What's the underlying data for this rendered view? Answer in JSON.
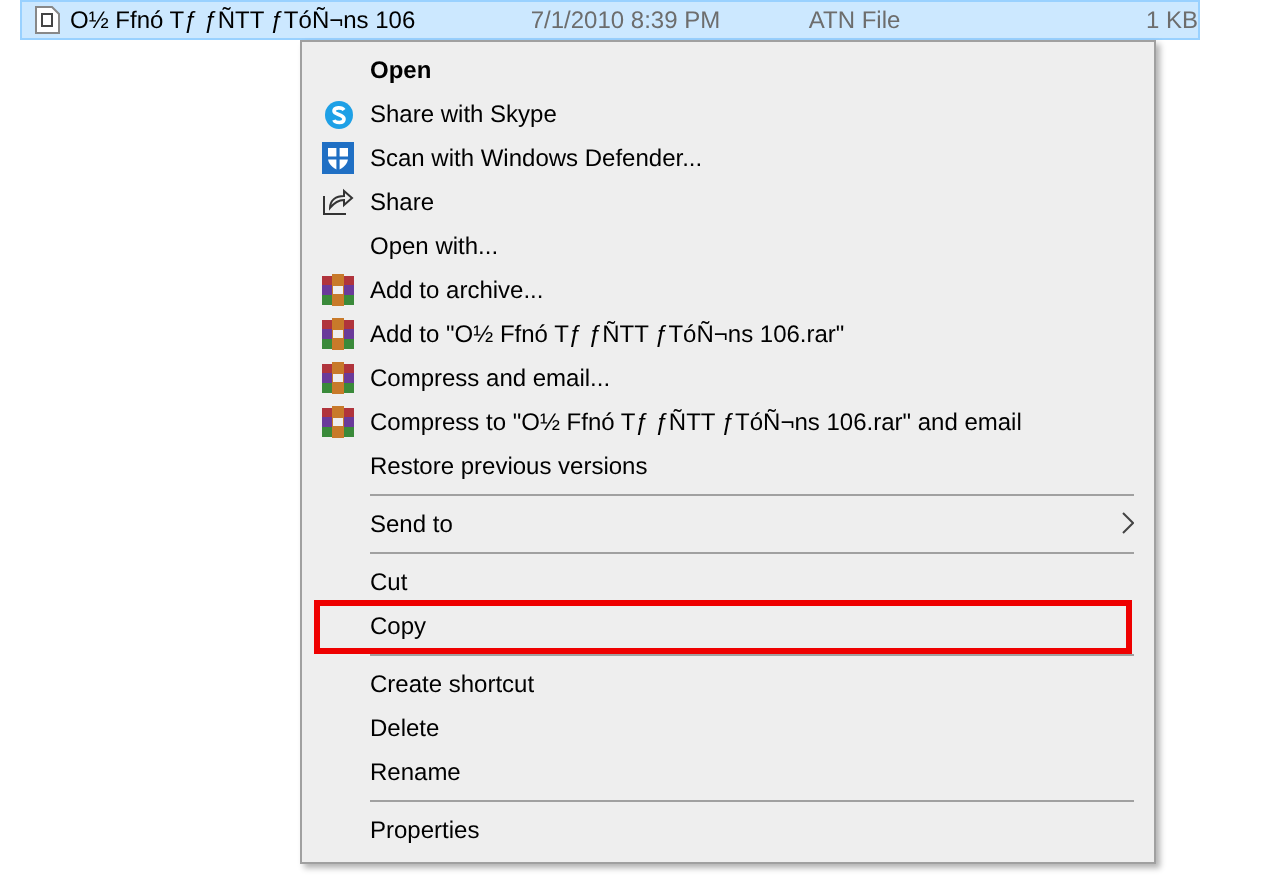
{
  "file_row": {
    "name": "O½ Ffnó Tƒ ƒÑTT ƒTóÑ¬ns 106",
    "date": "7/1/2010 8:39 PM",
    "type": "ATN File",
    "size": "1 KB",
    "selected": true
  },
  "context_menu": {
    "items": [
      {
        "kind": "plain",
        "label": "Open",
        "default": true,
        "submenu": false,
        "highlighted": false
      },
      {
        "kind": "skype",
        "label": "Share with Skype",
        "default": false,
        "submenu": false,
        "highlighted": false
      },
      {
        "kind": "defender",
        "label": "Scan with Windows Defender...",
        "default": false,
        "submenu": false,
        "highlighted": false
      },
      {
        "kind": "share",
        "label": "Share",
        "default": false,
        "submenu": false,
        "highlighted": false
      },
      {
        "kind": "plain",
        "label": "Open with...",
        "default": false,
        "submenu": false,
        "highlighted": false
      },
      {
        "kind": "archiver",
        "label": "Add to archive...",
        "default": false,
        "submenu": false,
        "highlighted": false
      },
      {
        "kind": "archiver",
        "label": "Add to \"O½ Ffnó Tƒ ƒÑTT ƒTóÑ¬ns 106.rar\"",
        "default": false,
        "submenu": false,
        "highlighted": false
      },
      {
        "kind": "archiver",
        "label": "Compress and email...",
        "default": false,
        "submenu": false,
        "highlighted": false
      },
      {
        "kind": "archiver",
        "label": "Compress to \"O½ Ffnó Tƒ ƒÑTT ƒTóÑ¬ns 106.rar\" and email",
        "default": false,
        "submenu": false,
        "highlighted": false
      },
      {
        "kind": "plain",
        "label": "Restore previous versions",
        "default": false,
        "submenu": false,
        "highlighted": false
      },
      {
        "kind": "separator"
      },
      {
        "kind": "plain",
        "label": "Send to",
        "default": false,
        "submenu": true,
        "highlighted": false
      },
      {
        "kind": "separator"
      },
      {
        "kind": "plain",
        "label": "Cut",
        "default": false,
        "submenu": false,
        "highlighted": false
      },
      {
        "kind": "plain",
        "label": "Copy",
        "default": false,
        "submenu": false,
        "highlighted": true
      },
      {
        "kind": "separator"
      },
      {
        "kind": "plain",
        "label": "Create shortcut",
        "default": false,
        "submenu": false,
        "highlighted": false
      },
      {
        "kind": "plain",
        "label": "Delete",
        "default": false,
        "submenu": false,
        "highlighted": false
      },
      {
        "kind": "plain",
        "label": "Rename",
        "default": false,
        "submenu": false,
        "highlighted": false
      },
      {
        "kind": "separator"
      },
      {
        "kind": "plain",
        "label": "Properties",
        "default": false,
        "submenu": false,
        "highlighted": false
      }
    ]
  }
}
